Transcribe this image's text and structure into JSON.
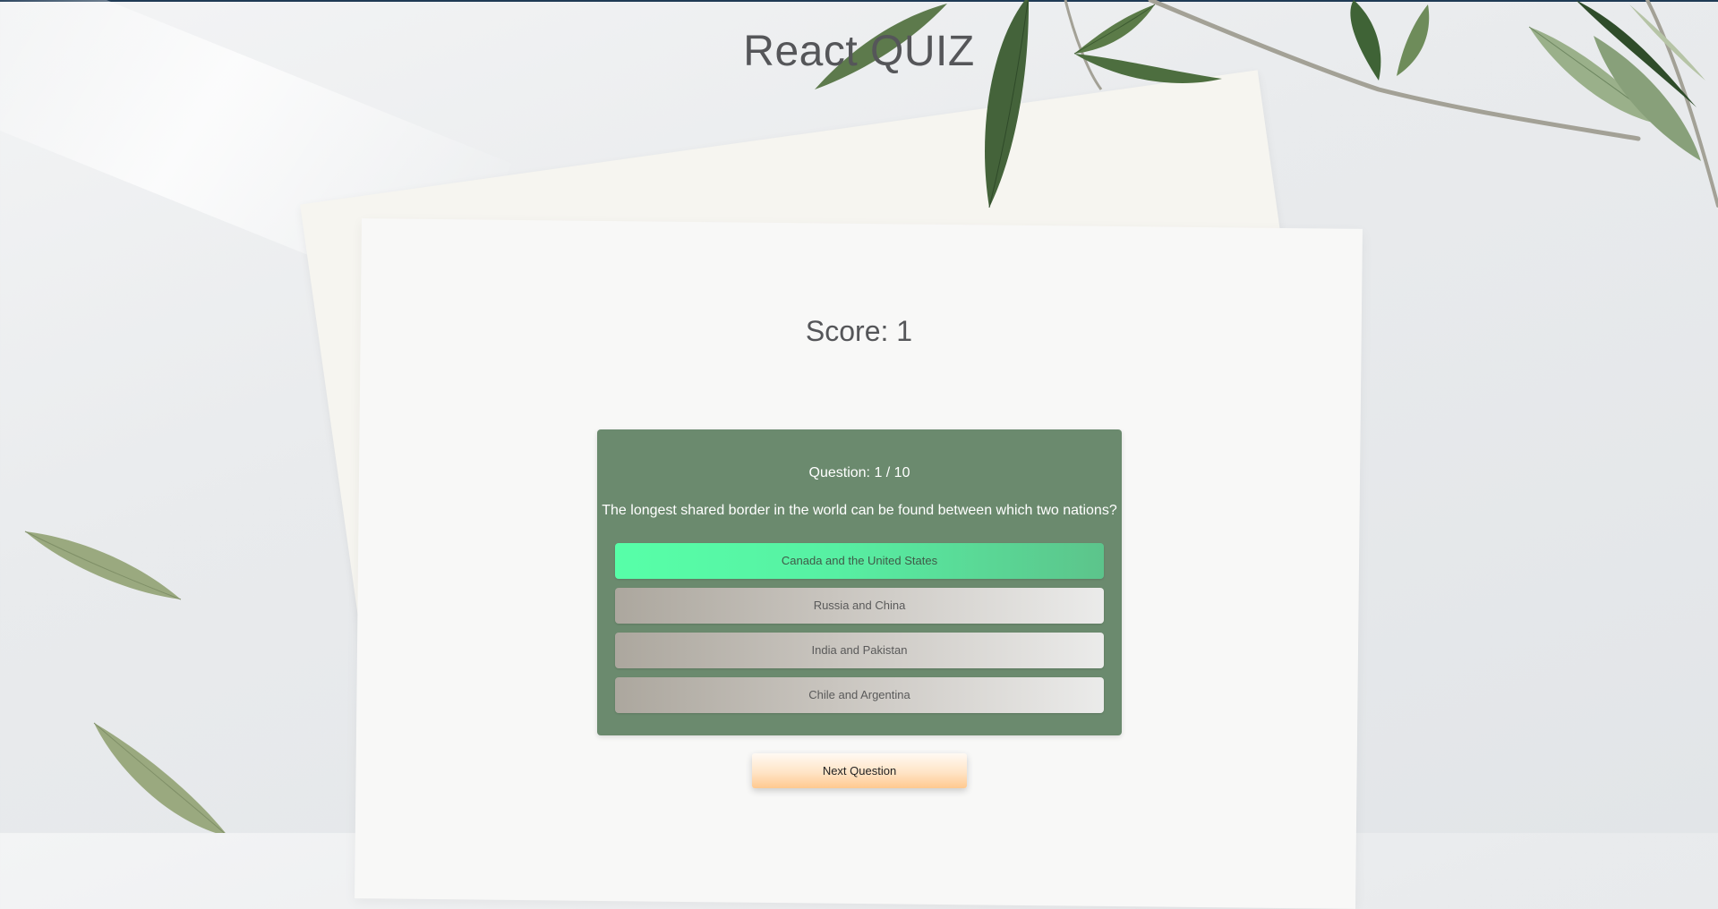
{
  "app": {
    "title": "React QUIZ"
  },
  "score": {
    "label": "Score: 1"
  },
  "question": {
    "counter": "Question: 1 / 10",
    "text": "The longest shared border in the world can be found between which two nations?",
    "answers": [
      {
        "label": "Canada and the United States",
        "state": "correct"
      },
      {
        "label": "Russia and China",
        "state": "default"
      },
      {
        "label": "India and Pakistan",
        "state": "default"
      },
      {
        "label": "Chile and Argentina",
        "state": "default"
      }
    ]
  },
  "controls": {
    "next_label": "Next Question"
  },
  "colors": {
    "card": "#6b8a6e",
    "correct_start": "#57ffa8",
    "correct_end": "#5cc48b",
    "answer_start": "#aca79e",
    "answer_end": "#ebebea",
    "next_button": "#ffd6aa",
    "title_text": "#555659"
  }
}
